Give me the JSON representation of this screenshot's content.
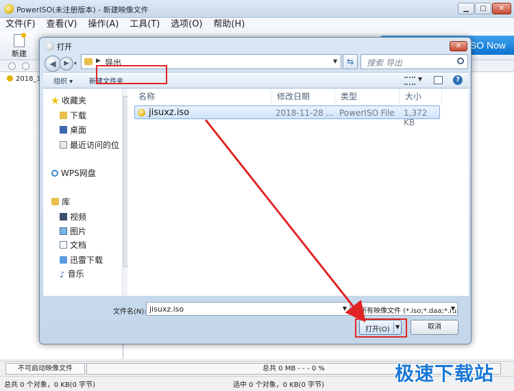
{
  "window": {
    "title": "PowerISO(未注册版本) - 新建映像文件",
    "min": "▁",
    "max": "□",
    "close": "✕"
  },
  "menu": [
    "文件(F)",
    "查看(V)",
    "操作(A)",
    "工具(T)",
    "选项(O)",
    "帮助(H)"
  ],
  "toolbar": {
    "new_label": "新建",
    "promo": "ISO Now"
  },
  "tree": {
    "item": "2018_1"
  },
  "dialog": {
    "title": "打开",
    "close": "✕",
    "address_path": "导出",
    "search_placeholder": "搜索 导出",
    "organize": "组织 ▾",
    "new_folder": "新建文件夹",
    "help": "?"
  },
  "nav": {
    "favorites": "收藏夹",
    "downloads": "下载",
    "desktop": "桌面",
    "recent": "最近访问的位",
    "wps": "WPS网盘",
    "library": "库",
    "videos": "视频",
    "pictures": "图片",
    "documents": "文档",
    "thunder": "迅雷下载",
    "music": "音乐"
  },
  "columns": {
    "name": "名称",
    "date": "修改日期",
    "type": "类型",
    "size": "大小"
  },
  "file": {
    "name": "jisuxz.iso",
    "date": "2018-11-28 ...",
    "type": "PowerISO File",
    "size": "1,372 KB"
  },
  "filename": {
    "label": "文件名(N):",
    "value": "jisuxz.iso"
  },
  "filetype": {
    "value": "所有映像文件 (*.iso;*.daa;*.ra"
  },
  "buttons": {
    "open": "打开(O)",
    "cancel": "取消"
  },
  "progress": {
    "boot": "不可启动映像文件",
    "total": "总共 0 MB    - - -  0 %"
  },
  "status": {
    "left": "总共 0 个对象，0 KB(0 字节)",
    "right": "选中 0 个对象，0 KB(0 字节)"
  },
  "watermark": "极速下载站",
  "colors": {
    "highlight": "#e02424",
    "accent": "#1a78d6"
  }
}
